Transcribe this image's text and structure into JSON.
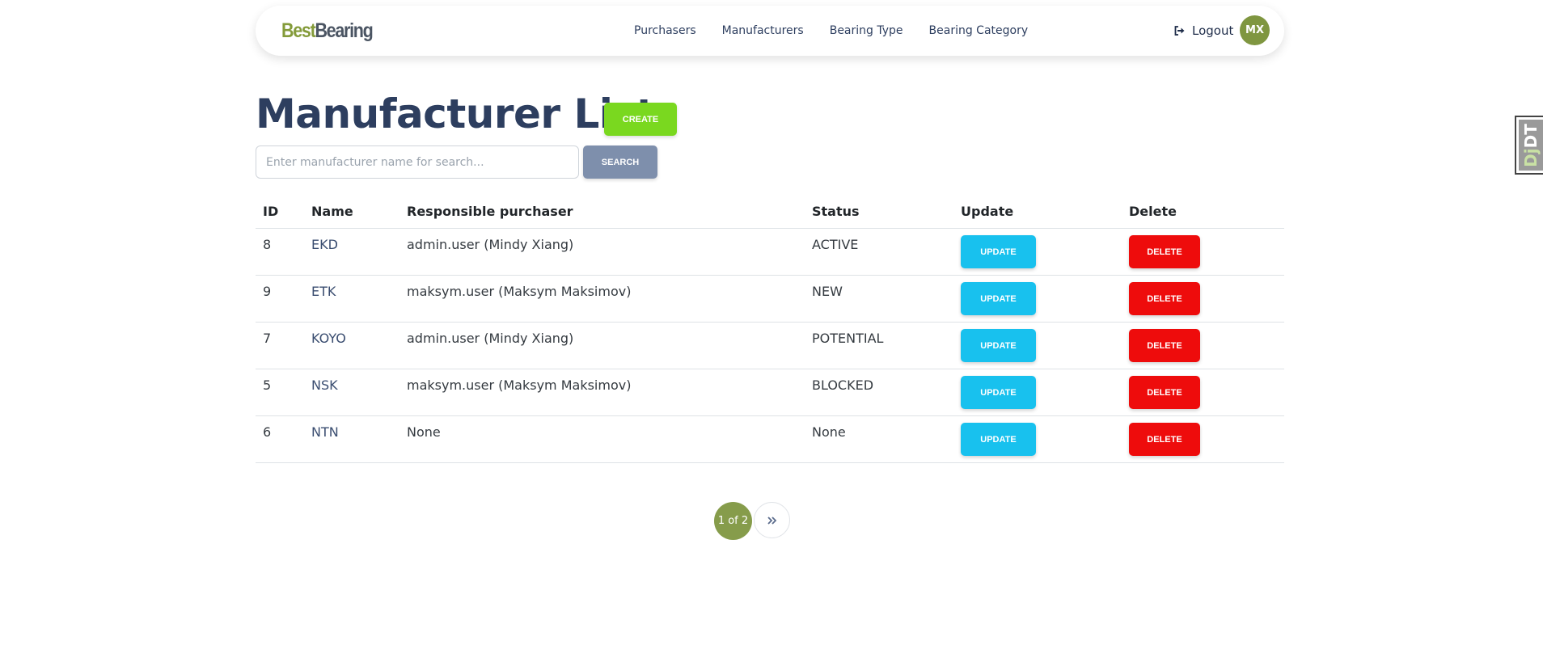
{
  "brand": {
    "part1": "Best",
    "part2": "Bearing"
  },
  "nav": {
    "links": [
      "Purchasers",
      "Manufacturers",
      "Bearing Type",
      "Bearing Category"
    ],
    "logout_label": "Logout",
    "logout_icon": "sign-out-icon",
    "avatar_initials": "MX"
  },
  "page": {
    "title": "Manufacturer List",
    "create_label": "CREATE"
  },
  "search": {
    "placeholder": "Enter manufacturer name for search...",
    "value": "",
    "button_label": "SEARCH"
  },
  "table": {
    "headers": {
      "id": "ID",
      "name": "Name",
      "responsible": "Responsible purchaser",
      "status": "Status",
      "update": "Update",
      "delete": "Delete"
    },
    "rows": [
      {
        "id": "8",
        "name": "EKD",
        "responsible": "admin.user (Mindy Xiang)",
        "status": "ACTIVE",
        "update_label": "UPDATE",
        "delete_label": "DELETE"
      },
      {
        "id": "9",
        "name": "ETK",
        "responsible": "maksym.user (Maksym Maksimov)",
        "status": "NEW",
        "update_label": "UPDATE",
        "delete_label": "DELETE"
      },
      {
        "id": "7",
        "name": "KOYO",
        "responsible": "admin.user (Mindy Xiang)",
        "status": "POTENTIAL",
        "update_label": "UPDATE",
        "delete_label": "DELETE"
      },
      {
        "id": "5",
        "name": "NSK",
        "responsible": "maksym.user (Maksym Maksimov)",
        "status": "BLOCKED",
        "update_label": "UPDATE",
        "delete_label": "DELETE"
      },
      {
        "id": "6",
        "name": "NTN",
        "responsible": "None",
        "status": "None",
        "update_label": "UPDATE",
        "delete_label": "DELETE"
      }
    ]
  },
  "pagination": {
    "current": "1 of 2",
    "next_icon": "double-chevron-right-icon"
  },
  "debug_toolbar": {
    "label_dj": "Dj",
    "label_dt": "DT"
  },
  "colors": {
    "brand_green": "#849b3a",
    "create": "#7ad81f",
    "search": "#7e8fac",
    "update": "#18c1ee",
    "delete": "#ee0c0c",
    "avatar": "#7f9640",
    "title": "#2d3e5f"
  }
}
